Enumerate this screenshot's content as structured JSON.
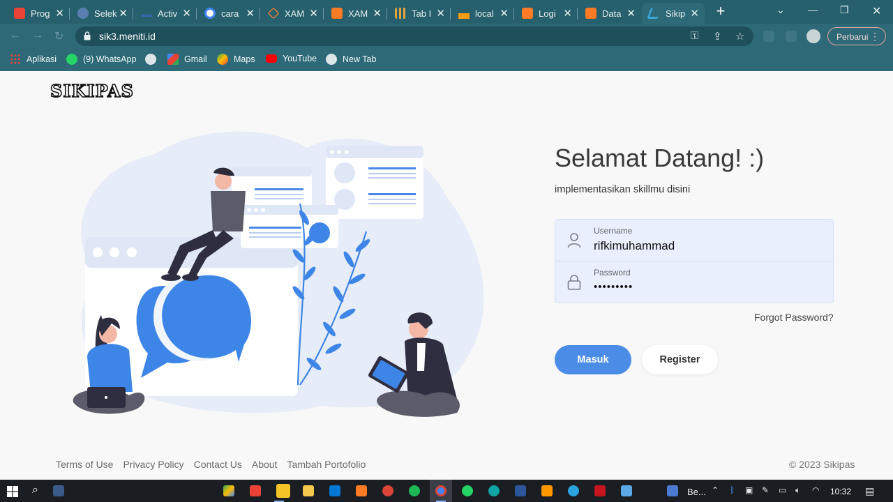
{
  "browser": {
    "tabs": [
      {
        "title": "Prog",
        "color": "#ea4335"
      },
      {
        "title": "Selek",
        "color": "#5a7fb0"
      },
      {
        "title": "Activ",
        "color": "#3566b6"
      },
      {
        "title": "cara",
        "color": "#ffffff"
      },
      {
        "title": "XAM",
        "color": "#e07b39"
      },
      {
        "title": "XAM",
        "color": "#fb7a24"
      },
      {
        "title": "Tab I",
        "color": "#e8a33d"
      },
      {
        "title": "local",
        "color": "#f39c12"
      },
      {
        "title": "Logi",
        "color": "#fb7a24"
      },
      {
        "title": "Data",
        "color": "#fb7a24"
      },
      {
        "title": "Sikip",
        "color": "#3da5d9"
      }
    ],
    "active_tab_index": 10,
    "url": "sik3.meniti.id",
    "update_label": "Perbarui",
    "bookmarks": [
      {
        "label": "Aplikasi",
        "icon": "apps-grid-icon"
      },
      {
        "label": "(9) WhatsApp",
        "icon": "whatsapp-icon"
      },
      {
        "label": "",
        "icon": "globe-icon"
      },
      {
        "label": "Gmail",
        "icon": "gmail-icon"
      },
      {
        "label": "Maps",
        "icon": "maps-icon"
      },
      {
        "label": "YouTube",
        "icon": "youtube-icon"
      },
      {
        "label": "New Tab",
        "icon": "globe-icon"
      }
    ]
  },
  "page": {
    "logo": "SIKIPAS",
    "welcome_title": "Selamat Datang! :)",
    "subtitle": "implementasikan skillmu disini",
    "username": {
      "label": "Username",
      "value": "rifkimuhammad"
    },
    "password": {
      "label": "Password",
      "value": "•••••••••"
    },
    "forgot_password": "Forgot Password?",
    "login_button": "Masuk",
    "register_button": "Register",
    "footer_links": [
      "Terms of Use",
      "Privacy Policy",
      "Contact Us",
      "About",
      "Tambah Portofolio"
    ],
    "copyright": "© 2023 Sikipas",
    "accent_color": "#4b8ce6"
  },
  "taskbar": {
    "search_label": "Be...",
    "clock": "10:32"
  }
}
